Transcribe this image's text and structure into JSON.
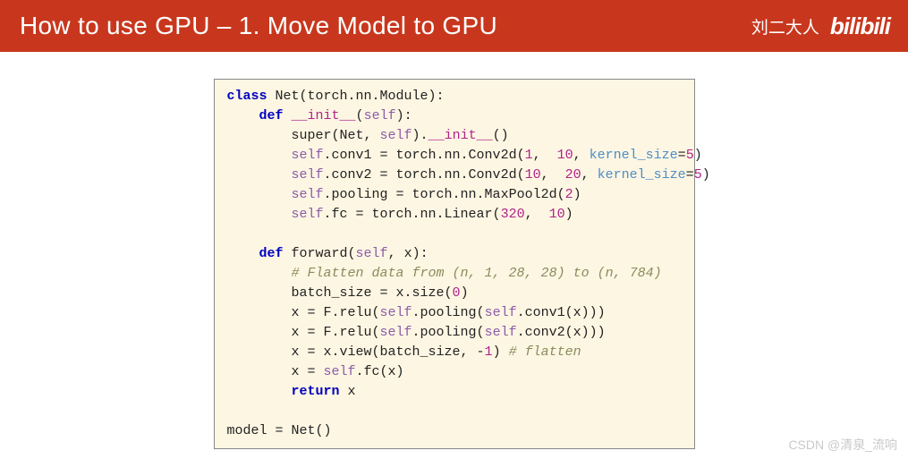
{
  "header": {
    "title": "How to use GPU – 1. Move Model to GPU",
    "author": "刘二大人",
    "logo": "bilibili"
  },
  "code": {
    "lines": [
      [
        {
          "t": "class ",
          "c": "kw"
        },
        {
          "t": "Net(torch.nn.Module):"
        }
      ],
      [
        {
          "t": "    "
        },
        {
          "t": "def ",
          "c": "kw"
        },
        {
          "t": "__init__",
          "c": "fn"
        },
        {
          "t": "("
        },
        {
          "t": "self",
          "c": "self"
        },
        {
          "t": "):"
        }
      ],
      [
        {
          "t": "        super(Net, "
        },
        {
          "t": "self",
          "c": "self"
        },
        {
          "t": ")."
        },
        {
          "t": "__init__",
          "c": "fn"
        },
        {
          "t": "()"
        }
      ],
      [
        {
          "t": "        "
        },
        {
          "t": "self",
          "c": "self"
        },
        {
          "t": ".conv1 = torch.nn.Conv2d("
        },
        {
          "t": "1",
          "c": "num"
        },
        {
          "t": ",  "
        },
        {
          "t": "10",
          "c": "num"
        },
        {
          "t": ", "
        },
        {
          "t": "kernel_size",
          "c": "arg"
        },
        {
          "t": "="
        },
        {
          "t": "5",
          "c": "num"
        },
        {
          "t": ")"
        }
      ],
      [
        {
          "t": "        "
        },
        {
          "t": "self",
          "c": "self"
        },
        {
          "t": ".conv2 = torch.nn.Conv2d("
        },
        {
          "t": "10",
          "c": "num"
        },
        {
          "t": ",  "
        },
        {
          "t": "20",
          "c": "num"
        },
        {
          "t": ", "
        },
        {
          "t": "kernel_size",
          "c": "arg"
        },
        {
          "t": "="
        },
        {
          "t": "5",
          "c": "num"
        },
        {
          "t": ")"
        }
      ],
      [
        {
          "t": "        "
        },
        {
          "t": "self",
          "c": "self"
        },
        {
          "t": ".pooling = torch.nn.MaxPool2d("
        },
        {
          "t": "2",
          "c": "num"
        },
        {
          "t": ")"
        }
      ],
      [
        {
          "t": "        "
        },
        {
          "t": "self",
          "c": "self"
        },
        {
          "t": ".fc = torch.nn.Linear("
        },
        {
          "t": "320",
          "c": "num"
        },
        {
          "t": ",  "
        },
        {
          "t": "10",
          "c": "num"
        },
        {
          "t": ")"
        }
      ],
      [],
      [
        {
          "t": "    "
        },
        {
          "t": "def ",
          "c": "kw"
        },
        {
          "t": "forward("
        },
        {
          "t": "self",
          "c": "self"
        },
        {
          "t": ", x):"
        }
      ],
      [
        {
          "t": "        "
        },
        {
          "t": "# Flatten data from (n, 1, 28, 28) to (n, 784)",
          "c": "cmt"
        }
      ],
      [
        {
          "t": "        batch_size = x.size("
        },
        {
          "t": "0",
          "c": "num"
        },
        {
          "t": ")"
        }
      ],
      [
        {
          "t": "        x = F.relu("
        },
        {
          "t": "self",
          "c": "self"
        },
        {
          "t": ".pooling("
        },
        {
          "t": "self",
          "c": "self"
        },
        {
          "t": ".conv1(x)))"
        }
      ],
      [
        {
          "t": "        x = F.relu("
        },
        {
          "t": "self",
          "c": "self"
        },
        {
          "t": ".pooling("
        },
        {
          "t": "self",
          "c": "self"
        },
        {
          "t": ".conv2(x)))"
        }
      ],
      [
        {
          "t": "        x = x.view(batch_size, -"
        },
        {
          "t": "1",
          "c": "num"
        },
        {
          "t": ") "
        },
        {
          "t": "# flatten",
          "c": "cmt"
        }
      ],
      [
        {
          "t": "        x = "
        },
        {
          "t": "self",
          "c": "self"
        },
        {
          "t": ".fc(x)"
        }
      ],
      [
        {
          "t": "        "
        },
        {
          "t": "return ",
          "c": "kw"
        },
        {
          "t": "x"
        }
      ],
      [],
      [
        {
          "t": "model = Net()"
        }
      ]
    ]
  },
  "watermark": "CSDN @清泉_流响"
}
